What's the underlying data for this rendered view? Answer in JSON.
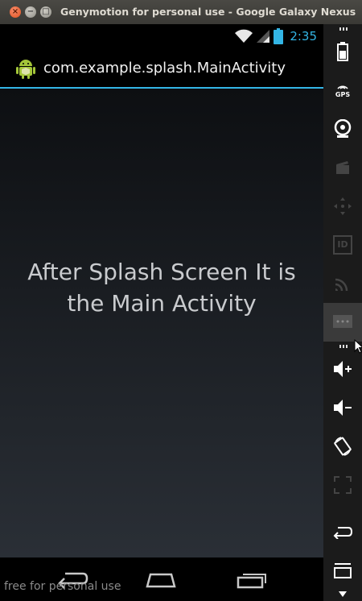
{
  "window": {
    "title": "Genymotion for personal use - Google Galaxy Nexus",
    "close_glyph": "×",
    "min_glyph": "−",
    "max_glyph": "□"
  },
  "status_bar": {
    "time": "2:35",
    "icons": [
      "wifi-icon",
      "signal-icon",
      "battery-icon"
    ],
    "accent_color": "#33b5e5"
  },
  "action_bar": {
    "title": "com.example.splash.MainActivity",
    "icon": "android-icon"
  },
  "content": {
    "message_line1": "After Splash Screen It is",
    "message_line2": "the Main Activity"
  },
  "nav_bar": {
    "buttons": [
      "back-icon",
      "home-icon",
      "recent-apps-icon"
    ]
  },
  "watermark": "free for personal use",
  "toolbar": {
    "items": [
      "battery-widget-icon",
      "gps-icon",
      "camera-icon",
      "capture-icon",
      "dpad-icon",
      "device-id-icon",
      "cast-icon",
      "sms-icon",
      "volume-up-icon",
      "volume-down-icon",
      "rotate-icon",
      "fullscreen-icon",
      "back-icon",
      "menu-icon"
    ],
    "gps_label": "GPS",
    "id_label": "ID"
  }
}
